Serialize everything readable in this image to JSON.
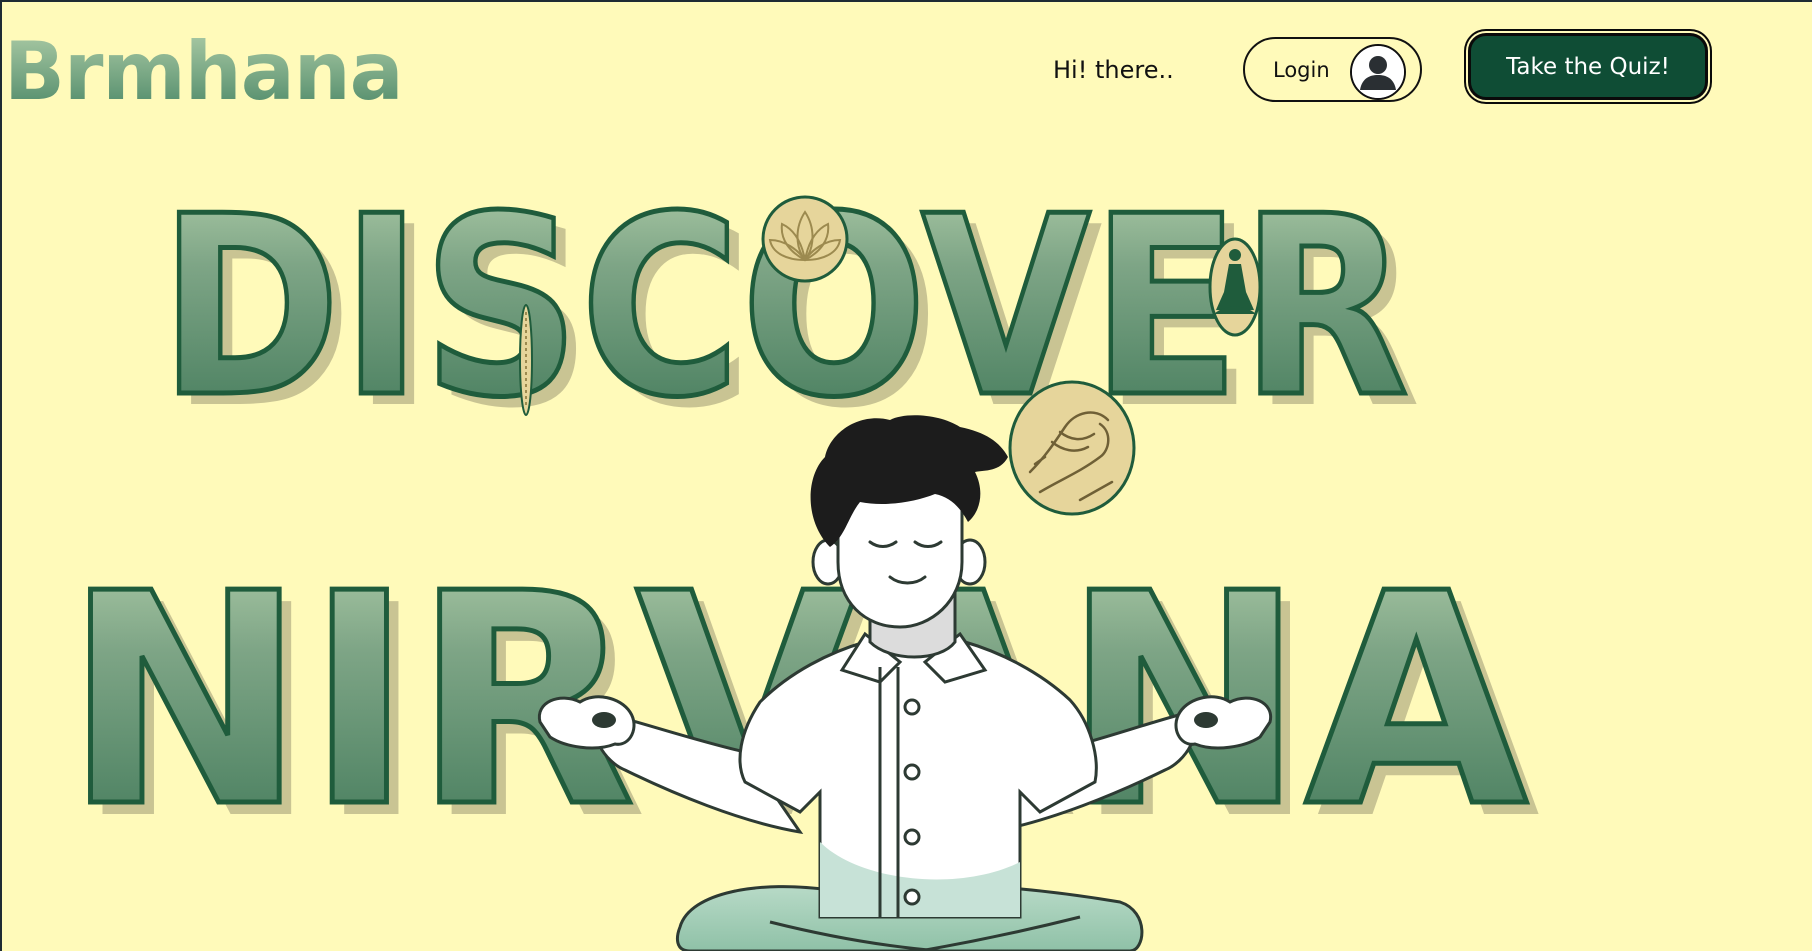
{
  "header": {
    "logo": "Brmhana",
    "greeting": "Hi! there..",
    "login_label": "Login",
    "quiz_label": "Take the Quiz!"
  },
  "hero": {
    "line1": "DISCOVER",
    "line2": "NIRVANA",
    "illustration": "meditating-person",
    "badges": [
      "lotus-icon",
      "meditation-pose-icon",
      "handshake-icon",
      "rosary-icon"
    ]
  },
  "colors": {
    "background": "#fffaba",
    "accent": "#0f4d35",
    "hero_text_top": "#a8c8a4",
    "hero_text_bottom": "#3f7a58",
    "hero_stroke": "#1f5c3c",
    "hero_shadow": "#c9c493",
    "badge_fill": "#e6d59b"
  }
}
